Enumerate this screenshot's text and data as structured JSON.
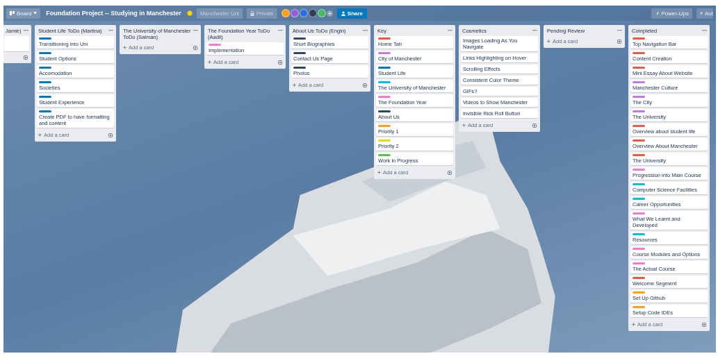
{
  "header": {
    "board_menu": "Board",
    "title": "Foundation Project -- Studying in Manchester",
    "starred": true,
    "team": "Manchester Uni",
    "visibility": "Private",
    "members": [
      {
        "color": "#ff9f1a"
      },
      {
        "color": "#8e5fd6"
      },
      {
        "color": "#2a6fdb"
      },
      {
        "color": "#2c3e50"
      },
      {
        "color": "#4bb866"
      }
    ],
    "share": "Share",
    "power_ups": "Power-Ups",
    "automation": "Aut"
  },
  "lists": [
    {
      "title": "Jamie)",
      "cards": [
        {
          "kind": "blank"
        }
      ]
    },
    {
      "title": "Student Life ToDo (Martina)",
      "cards": [
        {
          "text": "Transitioning into Uni",
          "color": "#0079bf"
        },
        {
          "text": "Student Options",
          "color": "#0079bf"
        },
        {
          "text": "Accomodation",
          "color": "#0079bf"
        },
        {
          "text": "Societies",
          "color": "#0079bf"
        },
        {
          "text": "Student Experience",
          "color": "#0079bf"
        },
        {
          "text": "Create PDF to have formatting and content",
          "color": "#0079bf"
        }
      ],
      "add_label": "Add a card"
    },
    {
      "title": "The University of Manchester ToDo (Salman)",
      "add_label": "Add a card"
    },
    {
      "title": "The Foundation Year ToDo (Aadil)",
      "cards": [
        {
          "text": "Implementation",
          "color": "#ff78cb"
        }
      ],
      "add_label": "Add a card"
    },
    {
      "title": "About Us ToDo (Engin)",
      "cards": [
        {
          "text": "Short Biographies",
          "color": "#344563"
        },
        {
          "text": "Contact Us Page",
          "color": "#344563"
        },
        {
          "text": "Photos",
          "color": "#344563"
        }
      ],
      "add_label": "Add a card"
    },
    {
      "title": "Key",
      "cards": [
        {
          "text": "Home Tab",
          "color": "#eb5a46"
        },
        {
          "text": "City of Manchester",
          "color": "#c377e0"
        },
        {
          "text": "Student Life",
          "color": "#0079bf"
        },
        {
          "text": "The University of Manchester",
          "color": "#00c2e0"
        },
        {
          "text": "The Foundation Year",
          "color": "#ff78cb"
        },
        {
          "text": "About Us",
          "color": "#344563"
        },
        {
          "text": "Priority 1",
          "color": "#ff9f1a"
        },
        {
          "text": "Priority 2",
          "color": "#f2d600"
        },
        {
          "text": "Work in Progress",
          "color": "#61bd4f"
        }
      ],
      "add_label": "Add a card"
    },
    {
      "title": "Cosmetics",
      "cards": [
        {
          "text": "Images Loading As You Navigate"
        },
        {
          "text": "Links Highlighting on Hover"
        },
        {
          "text": "Scrolling Effects"
        },
        {
          "text": "Consistent Color Theme"
        },
        {
          "text": "GIFs?"
        },
        {
          "text": "Videos to Show Manchester"
        },
        {
          "text": "Invisible Rick Roll Button"
        }
      ],
      "add_label": "Add a card"
    },
    {
      "title": "Pending Review",
      "add_label": "Add a card"
    },
    {
      "title": "Completed",
      "cards": [
        {
          "text": "Top Navigation Bar",
          "color": "#eb5a46"
        },
        {
          "text": "Content Creation",
          "color": "#eb5a46"
        },
        {
          "text": "Mini Essay About Website",
          "color": "#eb5a46"
        },
        {
          "text": "Manchester Culture",
          "color": "#c377e0"
        },
        {
          "text": "The City",
          "color": "#c377e0"
        },
        {
          "text": "The University",
          "color": "#c377e0"
        },
        {
          "text": "Overview about student life",
          "color": "#eb5a46"
        },
        {
          "text": "Overview About Manchester",
          "color": "#eb5a46"
        },
        {
          "text": "The University",
          "color": "#eb5a46"
        },
        {
          "text": "Progression into Main Course",
          "color": "#ff78cb"
        },
        {
          "text": "Computer Science Facilities",
          "color": "#00c2e0"
        },
        {
          "text": "Career Opportunities",
          "color": "#00c2e0"
        },
        {
          "text": "What We Learnt and Developed",
          "color": "#ff78cb"
        },
        {
          "text": "Resources",
          "color": "#00c2e0"
        },
        {
          "text": "Course Modules and Options",
          "color": "#ff78cb"
        },
        {
          "text": "The Actual Course",
          "color": "#ff78cb"
        },
        {
          "text": "Welcome Segment",
          "color": "#eb5a46"
        },
        {
          "text": "Set Up Github",
          "color": "#ff9f1a"
        },
        {
          "text": "Setup Code IDEs",
          "color": "#ff9f1a"
        }
      ],
      "add_label": "Add a card"
    }
  ]
}
